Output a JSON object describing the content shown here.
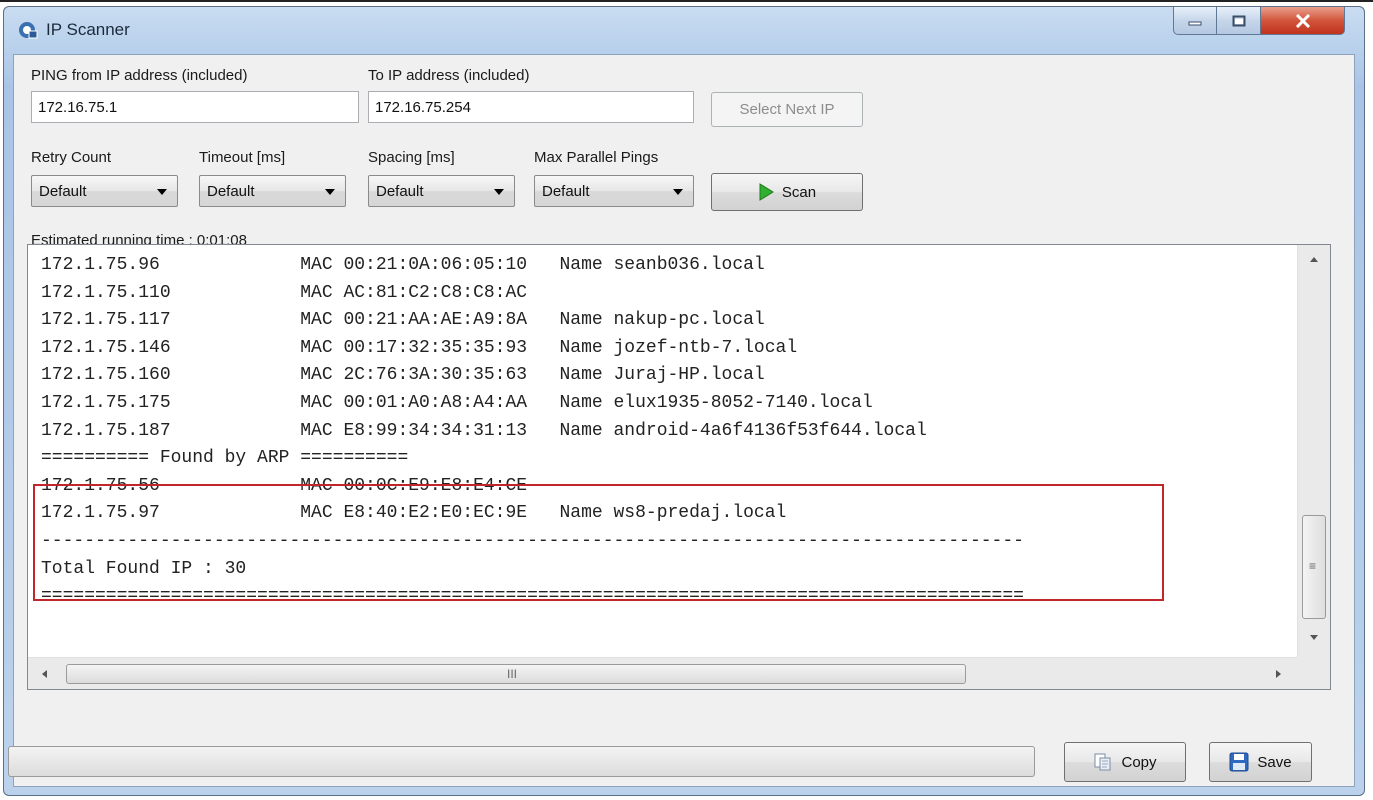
{
  "window": {
    "title": "IP Scanner",
    "minimize_icon": "minimize-icon",
    "maximize_icon": "maximize-icon",
    "close_icon": "close-icon"
  },
  "range": {
    "from_label": "PING from IP address (included)",
    "from_value": "172.16.75.1",
    "to_label": "To IP address (included)",
    "to_value": "172.16.75.254",
    "select_next_label": "Select Next IP"
  },
  "options": {
    "retry_label": "Retry Count",
    "retry_value": "Default",
    "timeout_label": "Timeout [ms]",
    "timeout_value": "Default",
    "spacing_label": "Spacing [ms]",
    "spacing_value": "Default",
    "parallel_label": "Max Parallel Pings",
    "parallel_value": "Default",
    "scan_label": "Scan"
  },
  "estimated_time": "Estimated running time : 0:01:08",
  "output": {
    "lines": [
      "172.1.75.96             MAC 00:21:0A:06:05:10   Name seanb036.local",
      "172.1.75.110            MAC AC:81:C2:C8:C8:AC",
      "172.1.75.117            MAC 00:21:AA:AE:A9:8A   Name nakup-pc.local",
      "172.1.75.146            MAC 00:17:32:35:35:93   Name jozef-ntb-7.local",
      "172.1.75.160            MAC 2C:76:3A:30:35:63   Name Juraj-HP.local",
      "172.1.75.175            MAC 00:01:A0:A8:A4:AA   Name elux1935-8052-7140.local",
      "172.1.75.187            MAC E8:99:34:34:31:13   Name android-4a6f4136f53f644.local",
      "========== Found by ARP ==========",
      "172.1.75.56             MAC 00:0C:E9:E8:E4:CE",
      "172.1.75.97             MAC E8:40:E2:E0:EC:9E   Name ws8-predaj.local",
      "-------------------------------------------------------------------------------------------",
      "Total Found IP : 30",
      "==========================================================================================="
    ],
    "hscroll_grip": "III",
    "vscroll_grip": "≡"
  },
  "footer": {
    "copy_label": "Copy",
    "save_label": "Save",
    "progress": 0
  },
  "colors": {
    "highlight_border": "#c0272d",
    "scan_icon": "#2fb02f",
    "close_button": "#c9442b"
  }
}
